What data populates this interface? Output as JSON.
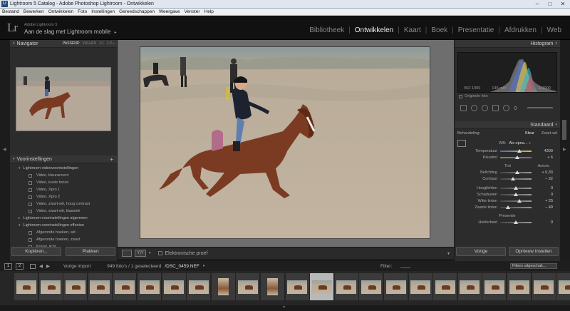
{
  "window": {
    "title": "Lightroom 5 Catalog - Adobe Photoshop Lightroom - Ontwikkelen",
    "app_icon": "Lr",
    "min": "–",
    "max": "□",
    "close": "✕"
  },
  "menu": [
    "Bestand",
    "Bewerken",
    "Ontwikkelen",
    "Foto",
    "Instellingen",
    "Gereedschappen",
    "Weergave",
    "Venster",
    "Help"
  ],
  "header": {
    "logo": "Lr",
    "app_name": "Adobe Lightroom 5",
    "message": "Aan de slag met Lightroom mobile",
    "message_arrow": "▸",
    "modules": [
      "Bibliotheek",
      "Ontwikkelen",
      "Kaart",
      "Boek",
      "Presentatie",
      "Afdrukken",
      "Web"
    ],
    "active_module": "Ontwikkelen"
  },
  "navigator": {
    "title": "Navigator",
    "tri": "▾",
    "options": [
      "PASSEND",
      "VULLEN",
      "1:1",
      "1:2 ÷"
    ]
  },
  "presets": {
    "title": "Voorinstellingen",
    "tri": "▾",
    "add": "+",
    "rows": [
      {
        "type": "group",
        "label": "Lightroom-videovoorinstellingen",
        "tri": "▾"
      },
      {
        "type": "item",
        "label": "Video, kleuraccent"
      },
      {
        "type": "item",
        "label": "Video, koele tonen"
      },
      {
        "type": "item",
        "label": "Video, Xpro 1"
      },
      {
        "type": "item",
        "label": "Video, Xpro 2"
      },
      {
        "type": "item",
        "label": "Video, zwart-wit, hoog contrast"
      },
      {
        "type": "item",
        "label": "Video, zwart-wit, klassiek"
      },
      {
        "type": "group",
        "label": "Lightroom-voorinstellingen algemeen",
        "tri": "▸"
      },
      {
        "type": "group",
        "label": "Lightroom-voorinstellingen effecten",
        "tri": "▾"
      },
      {
        "type": "item",
        "label": "Afgeronde hoeken, wit"
      },
      {
        "type": "item",
        "label": "Afgeronde hoeken, zwart"
      },
      {
        "type": "item",
        "label": "Korrel, licht"
      }
    ]
  },
  "left_buttons": {
    "copy": "Kopiëren...",
    "paste": "Plakken"
  },
  "toolbar": {
    "yy": "Y|Y",
    "proof_label": "Elektronische proef"
  },
  "histogram": {
    "title": "Histogram",
    "tri": "▾",
    "iso": "ISO 1000",
    "focal": "145 mm",
    "aperture": "f / 4,0",
    "shutter": "1/1000",
    "original": "Originele foto"
  },
  "basic": {
    "title": "Standaard",
    "tri": "▾",
    "treatment_label": "Behandeling:",
    "color": "Kleur",
    "bw": "Zwart-wit",
    "wb_label": "WB:",
    "wb_value": "Als opna... ÷",
    "sliders": [
      {
        "label": "Temperatuur",
        "value": "4300",
        "pos": 0.62
      },
      {
        "label": "Kleurtint",
        "value": "+ 6",
        "pos": 0.55
      }
    ],
    "tone_label": "Tint",
    "auto": "Autom.",
    "tone_sliders": [
      {
        "label": "Belichting",
        "value": "+ 0,33",
        "pos": 0.55
      },
      {
        "label": "Contrast",
        "value": "– 22",
        "pos": 0.4
      }
    ],
    "tone_sliders2": [
      {
        "label": "Hooglichten",
        "value": "0",
        "pos": 0.5
      },
      {
        "label": "Schaduwen",
        "value": "0",
        "pos": 0.5
      },
      {
        "label": "Witte tinten",
        "value": "+ 25",
        "pos": 0.62
      },
      {
        "label": "Zwarte tinten",
        "value": "– 49",
        "pos": 0.25
      }
    ],
    "presence_label": "Presentie",
    "clarity": {
      "label": "Helderheid",
      "value": "0",
      "pos": 0.5
    }
  },
  "right_buttons": {
    "prev": "Vorige",
    "reset": "Opnieuw instellen"
  },
  "filmbar": {
    "screen1": "1",
    "screen2": "2",
    "source": "Vorige import",
    "count": "949 foto's / 1 geselecteerd",
    "file": "/DSC_0459.NEF",
    "file_arrow": "▾",
    "filter_label": "Filter:",
    "filter_value": "Filters uitgeschak..."
  }
}
